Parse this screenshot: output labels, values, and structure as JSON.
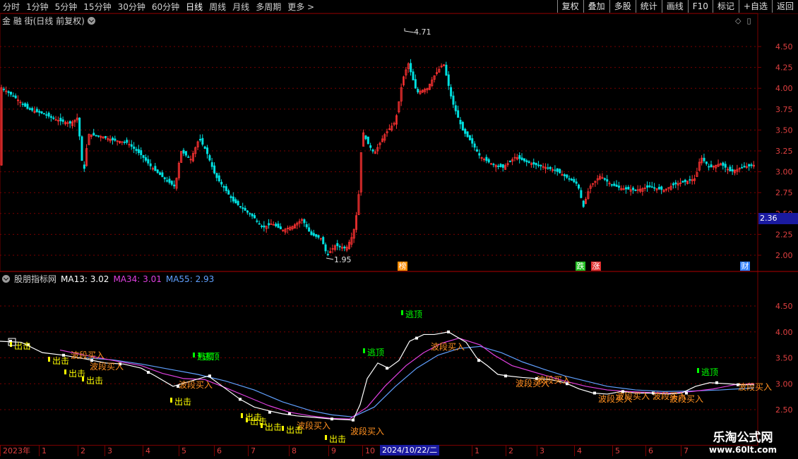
{
  "toolbar": {
    "periods": [
      "分时",
      "1分钟",
      "5分钟",
      "15分钟",
      "30分钟",
      "60分钟",
      "日线",
      "周线",
      "月线",
      "多周期",
      "更多 >"
    ],
    "active_period": "日线",
    "tools": [
      "复权",
      "叠加",
      "多股",
      "统计",
      "画线",
      "F10",
      "标记",
      "+自选",
      "返回"
    ]
  },
  "main": {
    "title": "金 融 街(日线 前复权)",
    "corner_icons": [
      "diamond-icon",
      "panel-icon"
    ],
    "price_axis": [
      "4.50",
      "4.25",
      "4.00",
      "3.75",
      "3.50",
      "3.25",
      "3.00",
      "2.75",
      "2.50",
      "2.25",
      "2.00"
    ],
    "high_label": "4.71",
    "low_label": "1.95",
    "current_price": "2.36",
    "event_tags": [
      {
        "label": "榜",
        "color": "#ff8c00"
      },
      {
        "label": "跌",
        "color": "#22c022"
      },
      {
        "label": "涨",
        "color": "#e03030"
      },
      {
        "label": "财",
        "color": "#3080ff"
      }
    ]
  },
  "indicator": {
    "title": "股朋指标网",
    "ma13_label": "MA13:",
    "ma13_value": "3.02",
    "ma34_label": "MA34:",
    "ma34_value": "3.01",
    "ma55_label": "MA55:",
    "ma55_value": "2.93",
    "axis": [
      "4.50",
      "4.00",
      "3.50",
      "3.00",
      "2.50"
    ],
    "signals": {
      "escape": "逃顶",
      "buy": "波段买入",
      "strike": "出击"
    }
  },
  "date_axis": {
    "ticks": [
      "2023年",
      "1",
      "2",
      "3",
      "4",
      "5",
      "6",
      "7",
      "8",
      "9",
      "10",
      "11",
      "12",
      "1",
      "2",
      "3",
      "4",
      "5",
      "6",
      "7"
    ],
    "highlight": "2024/10/22/二"
  },
  "watermark": {
    "cn": "乐淘公式网",
    "url": "www.60lt.com"
  },
  "colors": {
    "up": "#ff3232",
    "down": "#00e0e0",
    "grid": "#7a0000",
    "ma13": "#ffffff",
    "ma34": "#e040e0",
    "ma55": "#60a0ff",
    "buy": "#ff9020",
    "strike": "#ffff00",
    "escape": "#00ff00"
  }
}
